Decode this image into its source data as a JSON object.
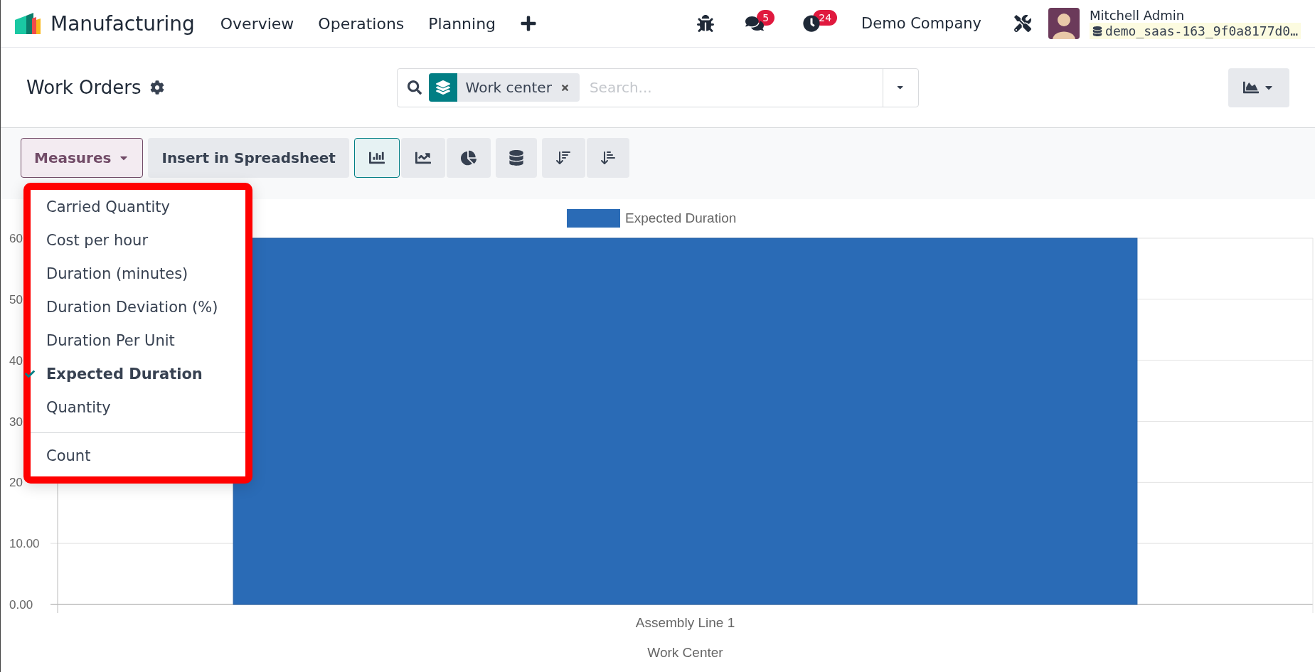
{
  "navbar": {
    "app_name": "Manufacturing",
    "menu": [
      {
        "label": "Overview"
      },
      {
        "label": "Operations"
      },
      {
        "label": "Planning"
      }
    ],
    "messages_count": "5",
    "activities_count": "24",
    "company": "Demo Company",
    "user": "Mitchell Admin",
    "database": "demo_saas-163_9f0a8177d0…"
  },
  "control_panel": {
    "title": "Work Orders",
    "search": {
      "facet": "Work center",
      "placeholder": "Search..."
    }
  },
  "toolbar": {
    "measures_label": "Measures",
    "insert_label": "Insert in Spreadsheet",
    "chart_types": [
      {
        "kind": "bar",
        "selected": true
      },
      {
        "kind": "line",
        "selected": false
      },
      {
        "kind": "pie",
        "selected": false
      }
    ],
    "stacked": {
      "on": false
    }
  },
  "measures_menu": {
    "items": [
      {
        "label": "Carried Quantity",
        "selected": false
      },
      {
        "label": "Cost per hour",
        "selected": false
      },
      {
        "label": "Duration (minutes)",
        "selected": false
      },
      {
        "label": "Duration Deviation (%)",
        "selected": false
      },
      {
        "label": "Duration Per Unit",
        "selected": false
      },
      {
        "label": "Expected Duration",
        "selected": true
      },
      {
        "label": "Quantity",
        "selected": false
      }
    ],
    "footer_items": [
      {
        "label": "Count",
        "selected": false
      }
    ]
  },
  "chart": {
    "chart_data": {
      "type": "bar",
      "xlabel": "Work Center",
      "categories": [
        "Assembly Line 1"
      ],
      "series": [
        {
          "name": "Expected Duration",
          "color": "#2a6bb6",
          "values": [
            60
          ]
        }
      ],
      "ylim": [
        0,
        60
      ],
      "grid": true,
      "yticks": [
        {
          "value": 0,
          "label": "0.00"
        },
        {
          "value": 10,
          "label": "10.00"
        },
        {
          "value": 20,
          "label": "20"
        },
        {
          "value": 30,
          "label": "30"
        },
        {
          "value": 40,
          "label": "40"
        },
        {
          "value": 50,
          "label": "50"
        },
        {
          "value": 60,
          "label": "60"
        }
      ]
    }
  }
}
